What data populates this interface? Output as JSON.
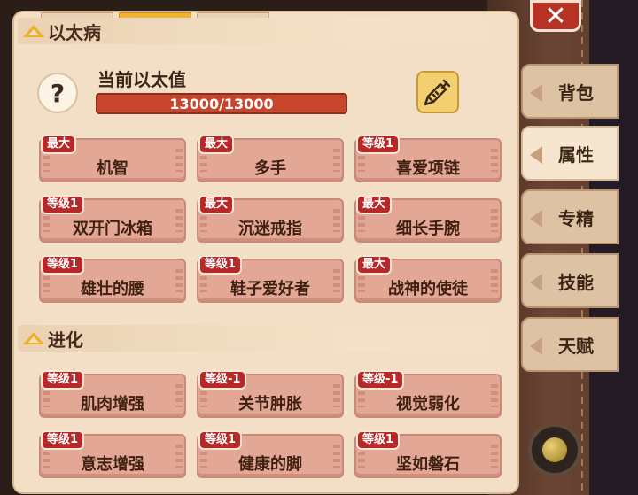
{
  "header": {
    "close_label": "✕"
  },
  "ether_section": {
    "title": "以太病",
    "current_label": "当前以太值",
    "current": 13000,
    "max": 13000,
    "value_text": "13000/13000",
    "help_label": "?",
    "edit_icon": "syringe-icon"
  },
  "ether_cards": [
    {
      "badge": "最大",
      "label": "机智"
    },
    {
      "badge": "最大",
      "label": "多手"
    },
    {
      "badge": "等级1",
      "label": "喜爱项链"
    },
    {
      "badge": "等级1",
      "label": "双开门冰箱"
    },
    {
      "badge": "最大",
      "label": "沉迷戒指"
    },
    {
      "badge": "最大",
      "label": "细长手腕"
    },
    {
      "badge": "等级1",
      "label": "雄壮的腰"
    },
    {
      "badge": "等级1",
      "label": "鞋子爱好者"
    },
    {
      "badge": "最大",
      "label": "战神的使徒"
    }
  ],
  "evolution_section": {
    "title": "进化"
  },
  "evolution_cards": [
    {
      "badge": "等级1",
      "label": "肌肉增强"
    },
    {
      "badge": "等级-1",
      "label": "关节肿胀"
    },
    {
      "badge": "等级-1",
      "label": "视觉弱化"
    },
    {
      "badge": "等级1",
      "label": "意志增强"
    },
    {
      "badge": "等级1",
      "label": "健康的脚"
    },
    {
      "badge": "等级1",
      "label": "坚如磐石"
    }
  ],
  "side_tabs": [
    {
      "label": "背包",
      "active": false
    },
    {
      "label": "属性",
      "active": true
    },
    {
      "label": "专精",
      "active": false
    },
    {
      "label": "技能",
      "active": false
    },
    {
      "label": "天赋",
      "active": false
    }
  ],
  "colors": {
    "panel": "#f3dfc5",
    "card": "#e2a895",
    "badge": "#b72828",
    "bar": "#c8462c",
    "accent": "#efb02a"
  }
}
